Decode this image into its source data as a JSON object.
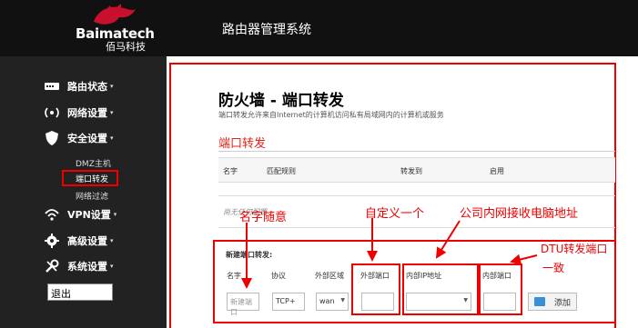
{
  "header": {
    "brand_name": "Baimatech",
    "brand_sub": "佰马科技",
    "system_title": "路由器管理系统"
  },
  "sidebar": {
    "items": [
      {
        "label": "路由状态",
        "icon": "status-icon"
      },
      {
        "label": "网络设置",
        "icon": "wifi-icon"
      },
      {
        "label": "安全设置",
        "icon": "shield-icon"
      },
      {
        "label": "VPN设置",
        "icon": "vpn-icon"
      },
      {
        "label": "高级设置",
        "icon": "gear-icon"
      },
      {
        "label": "系统设置",
        "icon": "wrench-icon"
      }
    ],
    "sub_items": [
      "DMZ主机",
      "端口转发",
      "网络过滤"
    ],
    "active_sub": "端口转发",
    "caret": "▾",
    "logout": "退出"
  },
  "main": {
    "title": "防火墙 - 端口转发",
    "description": "端口转发允许来自Internet的计算机访问私有局域网内的计算机或服务",
    "section_title": "端口转发",
    "table_headers": [
      "名字",
      "匹配规则",
      "转发到",
      "启用"
    ],
    "empty_text": "尚无任何配置",
    "new_section": {
      "title": "新建端口转发:",
      "col_headers": [
        "名字",
        "协议",
        "外部区域",
        "外部端口",
        "内部IP地址",
        "内部端口"
      ],
      "name_placeholder": "新建端口",
      "protocol_value": "TCP+",
      "zone_value": "wan",
      "external_port": "",
      "internal_ip": "",
      "internal_port": "",
      "add_label": "添加"
    }
  },
  "annotations": {
    "name_note": "名字随意",
    "ext_port_note": "自定义一个",
    "ip_note": "公司内网接收电脑地址",
    "dtu_note_1": "DTU转发端口",
    "dtu_note_2": "一致"
  },
  "colors": {
    "accent_red": "#e2231a",
    "annotation_red": "#ee0000",
    "sidebar_bg": "#222222",
    "header_bg": "#111111"
  }
}
